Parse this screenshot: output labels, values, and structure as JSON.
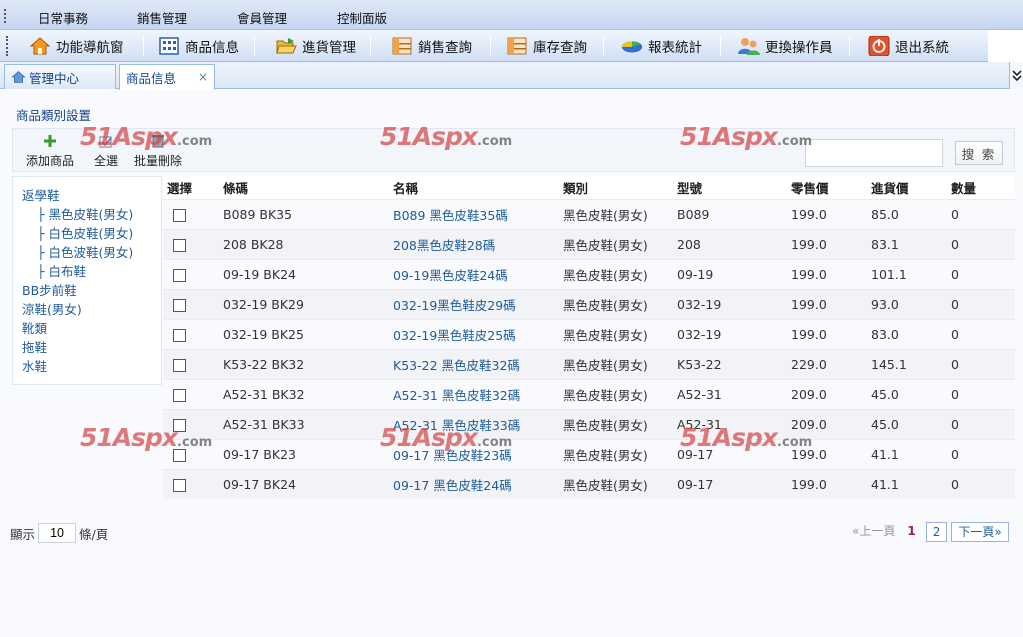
{
  "menu": [
    "日常事務",
    "銷售管理",
    "會員管理",
    "控制面版"
  ],
  "toolbar": [
    {
      "label": "功能導航窗",
      "icon": "home-icon"
    },
    {
      "label": "商品信息",
      "icon": "grid-icon"
    },
    {
      "label": "進貨管理",
      "icon": "folder-open-icon"
    },
    {
      "label": "銷售查詢",
      "icon": "sales-chart-icon"
    },
    {
      "label": "庫存查詢",
      "icon": "inventory-icon"
    },
    {
      "label": "報表統計",
      "icon": "pie-chart-icon"
    },
    {
      "label": "更換操作員",
      "icon": "users-icon"
    },
    {
      "label": "退出系統",
      "icon": "power-icon"
    }
  ],
  "tabs": [
    {
      "label": "管理中心",
      "icon": "home-icon"
    },
    {
      "label": "商品信息",
      "close": "×"
    }
  ],
  "page_title": "商品類別設置",
  "actions": [
    {
      "label": "添加商品",
      "icon": "plus-icon"
    },
    {
      "label": "全選",
      "icon": "select-all-icon"
    },
    {
      "label": "批量刪除",
      "icon": "delete-icon"
    }
  ],
  "search": {
    "value": "",
    "button": "搜 索"
  },
  "tree": [
    {
      "label": "返學鞋",
      "level": 0
    },
    {
      "label": "├ 黑色皮鞋(男女)",
      "level": 1
    },
    {
      "label": "├ 白色皮鞋(男女)",
      "level": 1
    },
    {
      "label": "├ 白色波鞋(男女)",
      "level": 1
    },
    {
      "label": "├ 白布鞋",
      "level": 1
    },
    {
      "label": "BB步前鞋",
      "level": 0
    },
    {
      "label": "涼鞋(男女)",
      "level": 0
    },
    {
      "label": "靴類",
      "level": 0
    },
    {
      "label": "拖鞋",
      "level": 0
    },
    {
      "label": "水鞋",
      "level": 0
    }
  ],
  "table": {
    "headers": [
      "選擇",
      "條碼",
      "名稱",
      "類別",
      "型號",
      "零售價",
      "進貨價",
      "數量"
    ],
    "rows": [
      [
        "B089 BK35",
        "B089 黑色皮鞋35碼",
        "黑色皮鞋(男女)",
        "B089",
        "199.0",
        "85.0",
        "0"
      ],
      [
        "208 BK28",
        "208黑色皮鞋28碼",
        "黑色皮鞋(男女)",
        "208",
        "199.0",
        "83.1",
        "0"
      ],
      [
        "09-19 BK24",
        "09-19黑色皮鞋24碼",
        "黑色皮鞋(男女)",
        "09-19",
        "199.0",
        "101.1",
        "0"
      ],
      [
        "032-19 BK29",
        "032-19黑色鞋皮29碼",
        "黑色皮鞋(男女)",
        "032-19",
        "199.0",
        "93.0",
        "0"
      ],
      [
        "032-19 BK25",
        "032-19黑色鞋皮25碼",
        "黑色皮鞋(男女)",
        "032-19",
        "199.0",
        "83.0",
        "0"
      ],
      [
        "K53-22 BK32",
        "K53-22 黑色皮鞋32碼",
        "黑色皮鞋(男女)",
        "K53-22",
        "229.0",
        "145.1",
        "0"
      ],
      [
        "A52-31 BK32",
        "A52-31 黑色皮鞋32碼",
        "黑色皮鞋(男女)",
        "A52-31",
        "209.0",
        "45.0",
        "0"
      ],
      [
        "A52-31 BK33",
        "A52-31 黑色皮鞋33碼",
        "黑色皮鞋(男女)",
        "A52-31",
        "209.0",
        "45.0",
        "0"
      ],
      [
        "09-17 BK23",
        "09-17 黑色皮鞋23碼",
        "黑色皮鞋(男女)",
        "09-17",
        "199.0",
        "41.1",
        "0"
      ],
      [
        "09-17 BK24",
        "09-17 黑色皮鞋24碼",
        "黑色皮鞋(男女)",
        "09-17",
        "199.0",
        "41.1",
        "0"
      ]
    ]
  },
  "pager": {
    "show_prefix": "顯示",
    "page_size": "10",
    "show_suffix": "條/頁",
    "prev": "«上一頁",
    "pages": [
      "1",
      "2"
    ],
    "next": "下一頁»"
  },
  "watermark": {
    "big": "51Aspx",
    "small": ".com"
  },
  "colors": {
    "link": "#1f5c99",
    "accent": "#15428b",
    "current_page": "#a21c5e",
    "watermark": "#d24646"
  }
}
